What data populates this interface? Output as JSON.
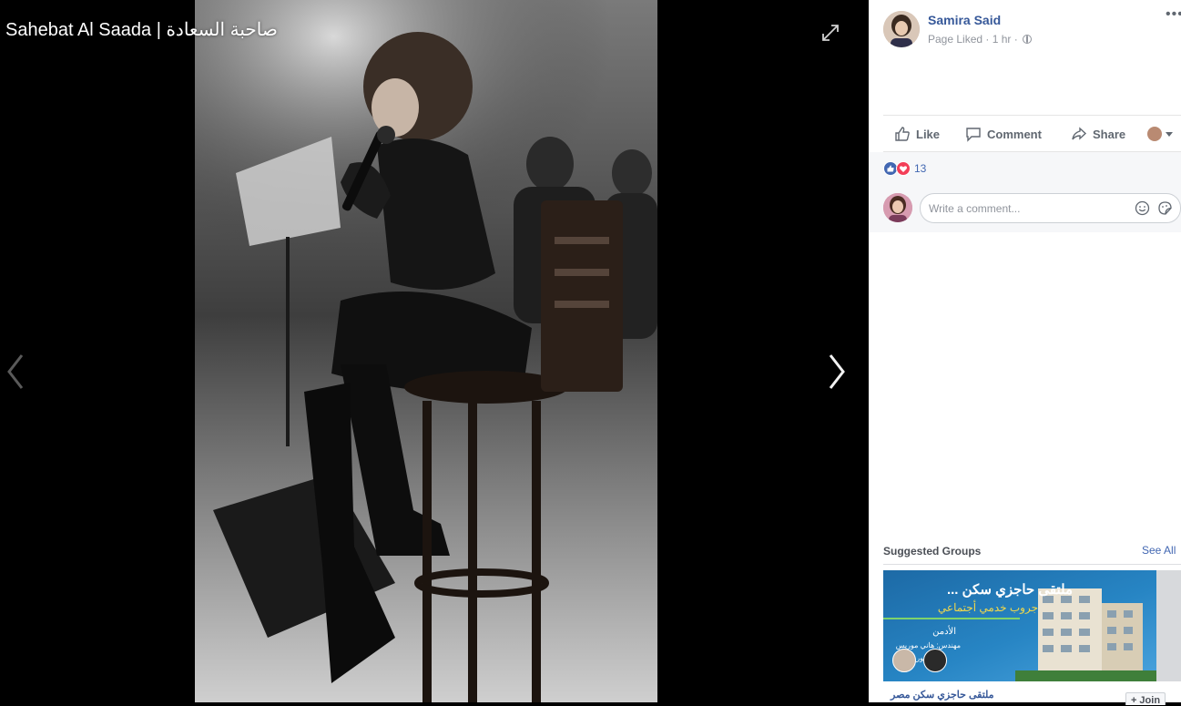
{
  "viewer": {
    "title": "Sahebat Al Saada | صاحبة السعادة",
    "expand_icon": "expand-icon",
    "prev_icon": "chevron-left-icon",
    "next_icon": "chevron-right-icon"
  },
  "post": {
    "author": "Samira Said",
    "meta": "Page Liked · 1 hr ·",
    "actions": {
      "like": "Like",
      "comment": "Comment",
      "share": "Share"
    },
    "reactions": {
      "count": "13",
      "types": [
        "like",
        "love"
      ]
    },
    "comment_placeholder": "Write a comment..."
  },
  "suggested_groups": {
    "title": "Suggested Groups",
    "see_all": "See All",
    "card": {
      "line1": "ملتقى حاجزي سكن ...",
      "line2": "جروب خدمي أجتماعي",
      "line3": "الأدمن",
      "line4": "مهندس: هاني موريس",
      "line5": "دكتور"
    },
    "group_name": "ملتقى حاجزي سكن مصر",
    "join_label": "+ Join"
  },
  "colors": {
    "link": "#365899",
    "accent": "#4267b2",
    "love": "#f33e58",
    "muted": "#90949c"
  }
}
